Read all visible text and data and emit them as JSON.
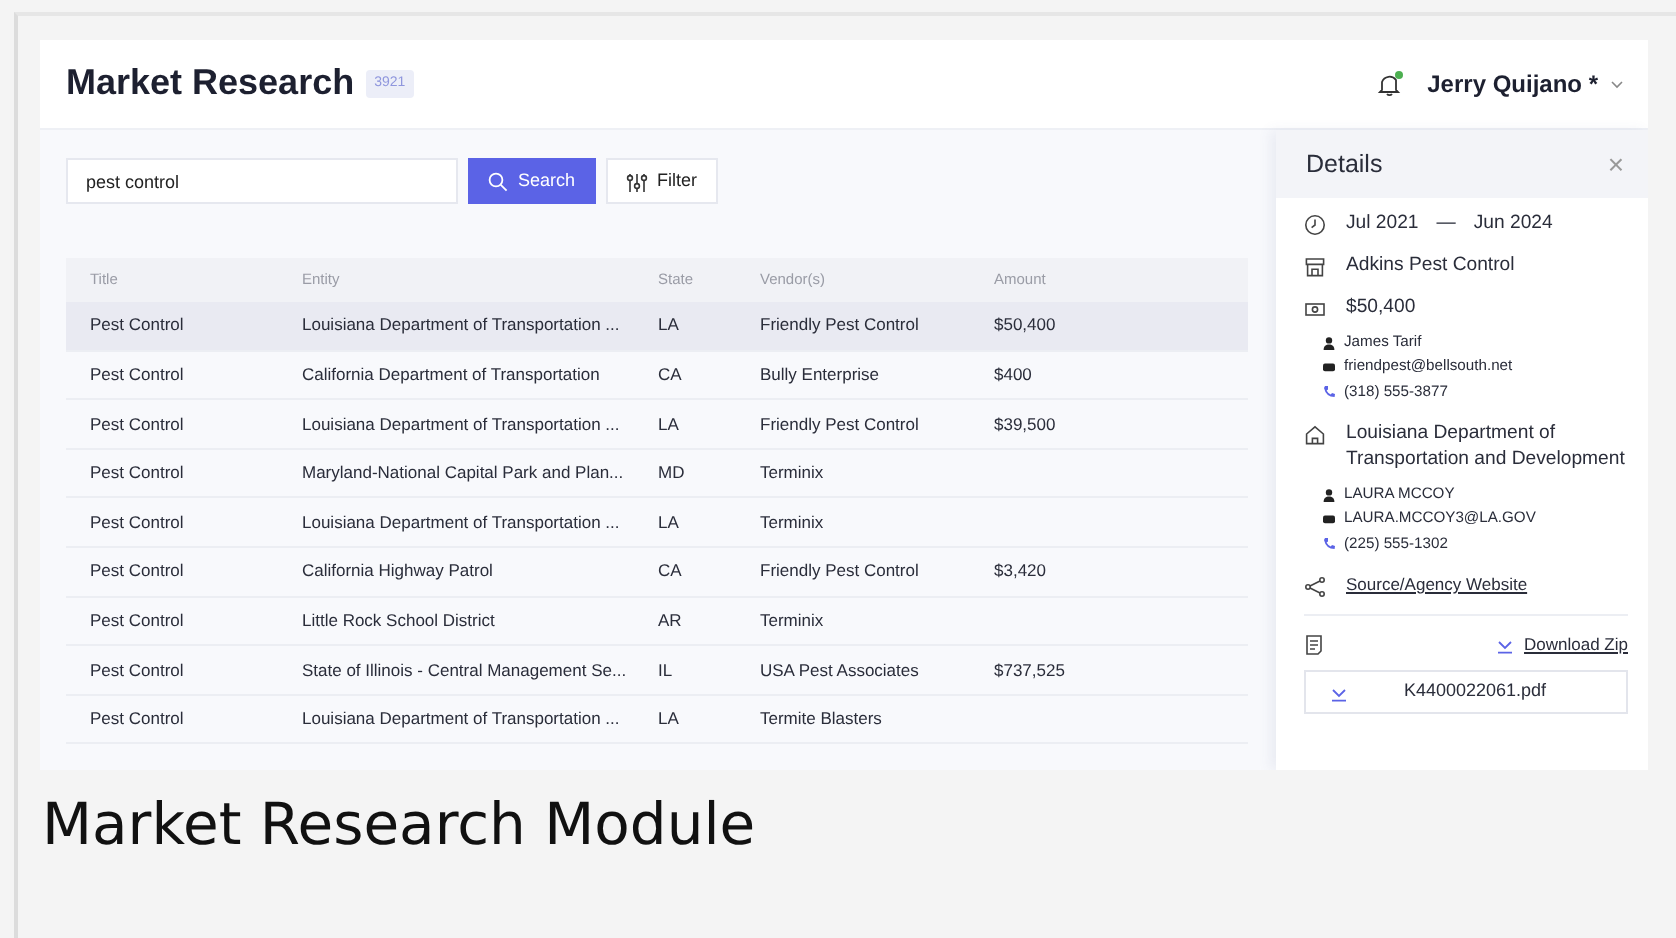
{
  "header": {
    "title": "Market Research",
    "count": "3921",
    "has_notification": true,
    "user": {
      "name": "Jerry Quijano *"
    }
  },
  "search": {
    "value": "pest control",
    "button": "Search",
    "filter_button": "Filter"
  },
  "table": {
    "columns": [
      "Title",
      "Entity",
      "State",
      "Vendor(s)",
      "Amount"
    ],
    "rows": [
      {
        "title": "Pest Control",
        "entity": "Louisiana Department of Transportation ...",
        "state": "LA",
        "vendors": "Friendly Pest Control",
        "amount": "$50,400",
        "selected": true
      },
      {
        "title": "Pest Control",
        "entity": "California Department of Transportation",
        "state": "CA",
        "vendors": "Bully Enterprise",
        "amount": "$400",
        "selected": false
      },
      {
        "title": "Pest Control",
        "entity": "Louisiana Department of Transportation ...",
        "state": "LA",
        "vendors": "Friendly Pest Control",
        "amount": "$39,500",
        "selected": false
      },
      {
        "title": "Pest Control",
        "entity": "Maryland-National Capital Park and Plan...",
        "state": "MD",
        "vendors": "Terminix",
        "selected": false
      },
      {
        "title": "Pest Control",
        "entity": "Louisiana Department of Transportation ...",
        "state": "LA",
        "vendors": "Terminix",
        "selected": false
      },
      {
        "title": "Pest Control",
        "entity": "California Highway Patrol",
        "state": "CA",
        "vendors": "Friendly Pest Control",
        "amount": "$3,420",
        "selected": false
      },
      {
        "title": "Pest Control",
        "entity": "Little Rock School District",
        "state": "AR",
        "vendors": "Terminix",
        "selected": false
      },
      {
        "title": "Pest Control",
        "entity": "State of Illinois - Central Management Se...",
        "state": "IL",
        "vendors": "USA Pest Associates",
        "amount": "$737,525",
        "selected": false
      },
      {
        "title": "Pest Control",
        "entity": "Louisiana Department of Transportation ...",
        "state": "LA",
        "vendors": "Termite Blasters",
        "selected": false
      }
    ]
  },
  "details": {
    "title": "Details",
    "close_glyph": "×",
    "period": {
      "start": "Jul 2021",
      "separator": "—",
      "end": "Jun 2024"
    },
    "vendor": "Adkins Pest Control",
    "amount": "$50,400",
    "vendor_contact": {
      "name": "James Tarif",
      "email": "friendpest@bellsouth.net",
      "phone": "(318) 555-3877"
    },
    "entity": "Louisiana Department of Transportation and Development",
    "entity_contact": {
      "name": "LAURA MCCOY",
      "email": "LAURA.MCCOY3@LA.GOV",
      "phone": "(225) 555-1302"
    },
    "source_link": "Source/Agency Website",
    "download_link": "Download Zip",
    "files": [
      "K4400022061.pdf"
    ]
  },
  "caption": "Market Research Module"
}
